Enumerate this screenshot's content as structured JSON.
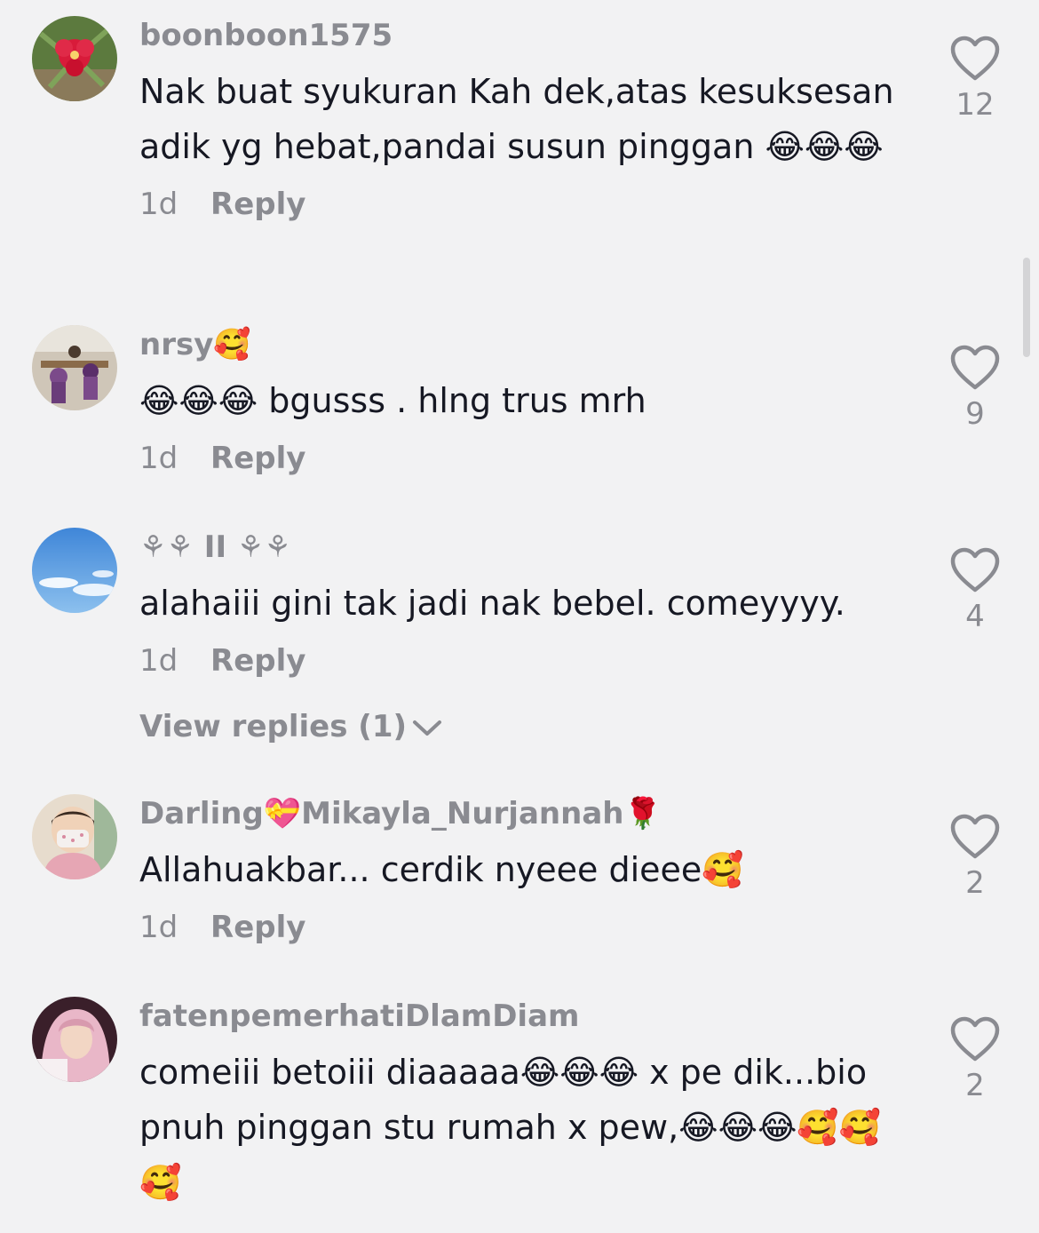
{
  "comments": [
    {
      "username": "boonboon1575",
      "text": "Nak buat syukuran Kah dek,atas kesuksesan adik yg hebat,pandai susun pinggan 😂😂😂",
      "time": "1d",
      "reply_label": "Reply",
      "like_count": "12"
    },
    {
      "username": "nrsy🥰",
      "text": "😂😂😂 bgusss . hlng trus mrh",
      "time": "1d",
      "reply_label": "Reply",
      "like_count": "9"
    },
    {
      "username": "⚘⚘ II ⚘⚘",
      "text": "alahaiii gini tak jadi nak bebel. comeyyyy.",
      "time": "1d",
      "reply_label": "Reply",
      "like_count": "4",
      "view_replies": "View replies (1)"
    },
    {
      "username": "Darling💝Mikayla_Nurjannah🌹",
      "text": "Allahuakbar... cerdik nyeee dieee🥰",
      "time": "1d",
      "reply_label": "Reply",
      "like_count": "2"
    },
    {
      "username": "fatenpemerhatiDlamDiam",
      "text": "comeiii betoiii diaaaaa😂😂😂 x pe dik...bio pnuh pinggan stu rumah x pew,😂😂😂🥰🥰🥰",
      "like_count": "2"
    }
  ],
  "icons": {
    "like": "heart-outline-icon",
    "expand": "chevron-down-icon"
  },
  "colors": {
    "background": "#f2f2f3",
    "primary_text": "#161823",
    "secondary_text": "#8a8b91"
  }
}
